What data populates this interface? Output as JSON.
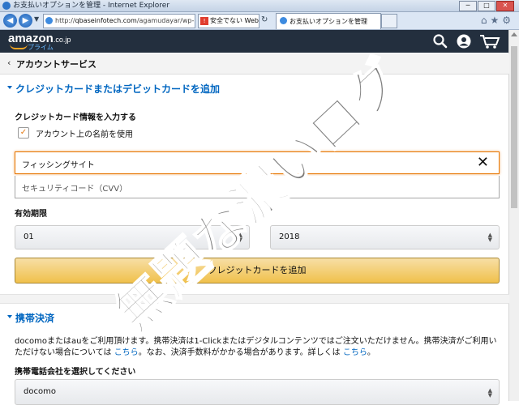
{
  "browser": {
    "window_title": "お支払いオプションを管理 - Internet Explorer",
    "url_host": "qbaseinfotech.com",
    "url_path": "/agamudayar/wp-in",
    "security_warning": "安全でない Web...",
    "active_tab": "お支払いオプションを管理",
    "window_buttons": {
      "minimize": "─",
      "restore": "□",
      "close": "✕"
    },
    "tool_icons": "⌂★⚙"
  },
  "amazon": {
    "logo": "amazon",
    "logo_suffix": ".co.jp",
    "prime": "プライム"
  },
  "subnav": {
    "back": "‹",
    "title": "アカウントサービス"
  },
  "card_section": {
    "title": "クレジットカードまたはデビットカードを追加",
    "info_label": "クレジットカード情報を入力する",
    "use_name_label": "アカウント上の名前を使用",
    "use_name_checked": true,
    "check_mark": "✓",
    "number_value": "フィッシングサイト",
    "clear_icon": "✕",
    "cvv_placeholder": "セキュリティコード（CVV）",
    "expiry_label": "有効期限",
    "month": "01",
    "year": "2018",
    "add_button": "クレジットカードを追加"
  },
  "mobile_section": {
    "title": "携帯決済",
    "desc_1": "docomoまたはauをご利用頂けます。携帯決済は1-Clickまたはデジタルコンテンツではご注文いただけません。携帯決済がご利用いただけない場合については ",
    "link_1": "こちら",
    "desc_2": "。なお、決済手数料がかかる場合があります。詳しくは ",
    "link_2": "こちら",
    "desc_3": "。",
    "carrier_label": "携帯電話会社を選択してください",
    "carrier": "docomo"
  },
  "watermark": "無題な濃いログ",
  "colors": {
    "header_bg": "#232f3e",
    "link_blue": "#0066c0",
    "button_yellow": "#f0c14b",
    "focus_orange": "#e77600",
    "watermark_gray": "#6a6a6a"
  }
}
